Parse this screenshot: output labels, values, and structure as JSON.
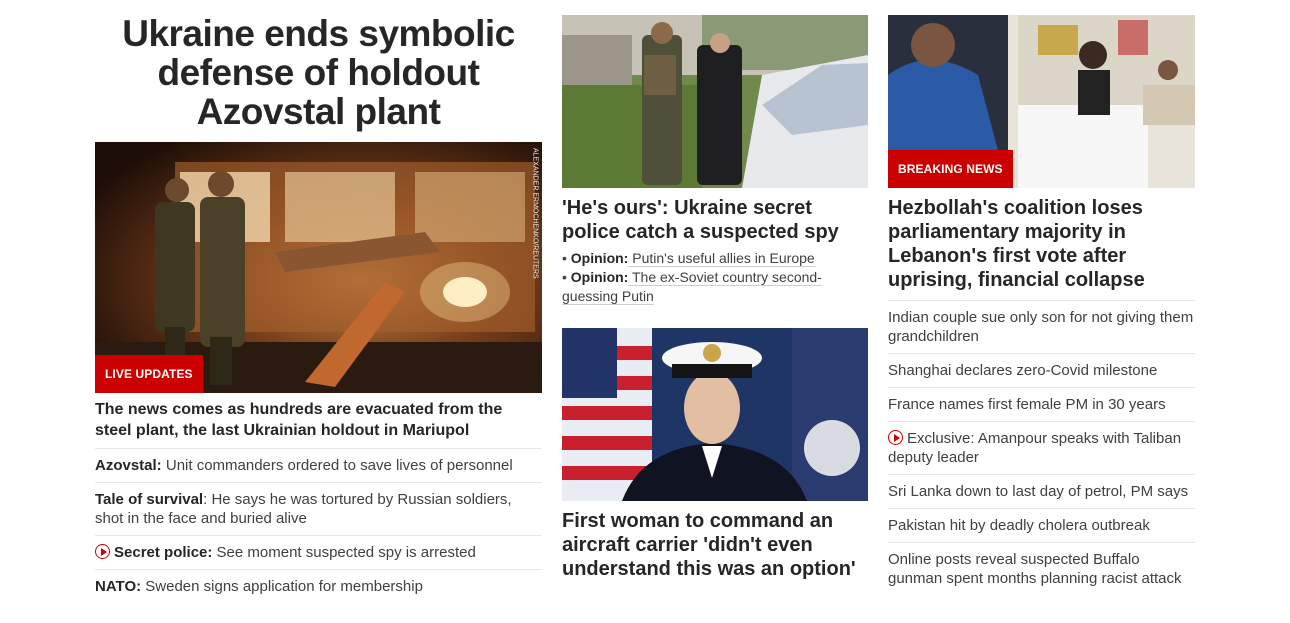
{
  "col1": {
    "headline": "Ukraine ends symbolic defense of holdout Azovstal plant",
    "hero_label": "LIVE UPDATES",
    "hero_credit": "ALEXANDER ERMOCHENKO/REUTERS",
    "caption": "The news comes as hundreds are evacuated from the steel plant, the last Ukrainian holdout in Mariupol",
    "items": [
      {
        "prefix": "Azovstal:",
        "text": " Unit commanders ordered to save lives of personnel"
      },
      {
        "prefix": "Tale of survival",
        "text": ": He says he was tortured by Russian soldiers, shot in the face and buried alive"
      },
      {
        "prefix": "Secret police:",
        "text": " See moment suspected spy is arrested"
      },
      {
        "prefix": "NATO:",
        "text": " Sweden signs application for membership"
      }
    ]
  },
  "col2": {
    "story1_headline": "'He's ours': Ukraine secret police catch a suspected spy",
    "sub_links": [
      {
        "bullet": "• ",
        "prefix": "Opinion:",
        "text": " Putin's useful allies in Europe"
      },
      {
        "bullet": "• ",
        "prefix": "Opinion:",
        "text": " The ex-Soviet country second-guessing Putin"
      }
    ],
    "story2_headline": "First woman to command an aircraft carrier 'didn't even understand this was an option'"
  },
  "col3": {
    "label": "BREAKING NEWS",
    "headline": "Hezbollah's coalition loses parliamentary majority in Lebanon's first vote after uprising, financial collapse",
    "items": [
      "Indian couple sue only son for not giving them grandchildren",
      "Shanghai declares zero-Covid milestone",
      "France names first female PM in 30 years",
      "Exclusive: Amanpour speaks with Taliban deputy leader",
      "Sri Lanka down to last day of petrol, PM says",
      "Pakistan hit by deadly cholera outbreak",
      "Online posts reveal suspected Buffalo gunman spent months planning racist attack"
    ]
  }
}
